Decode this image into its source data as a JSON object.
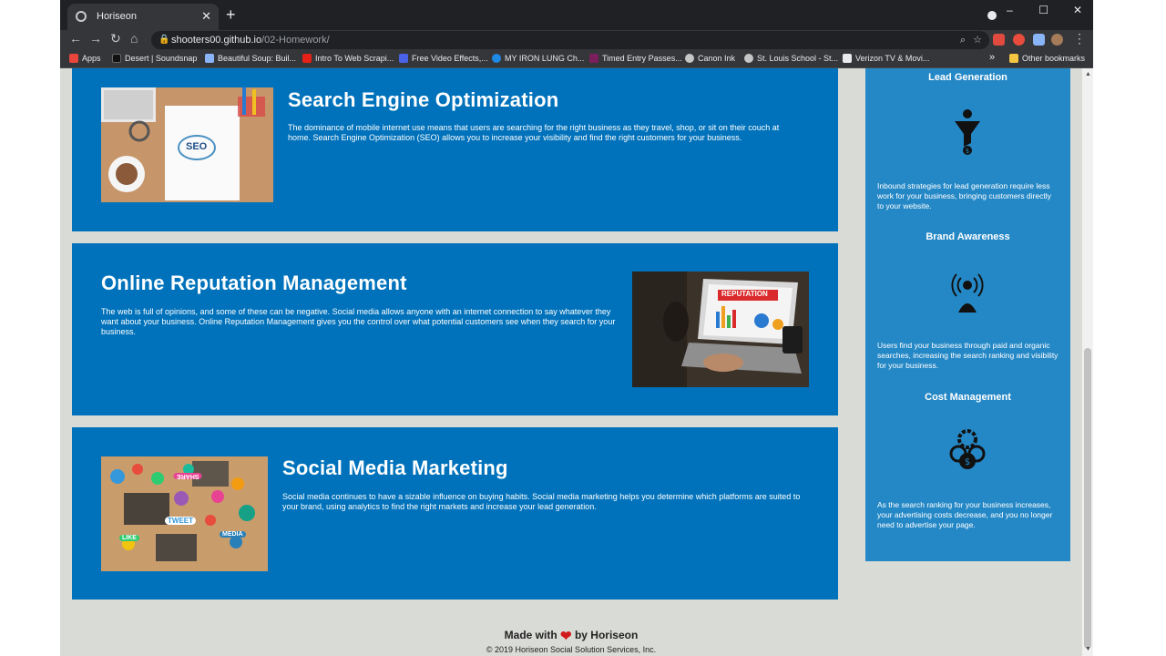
{
  "browser": {
    "tab_title": "Horiseon",
    "tab_close": "✕",
    "new_tab": "+",
    "url_host": "shooters00.github.io",
    "url_path": "/02-Homework/",
    "window_controls": [
      "–",
      "☐",
      "✕"
    ]
  },
  "bookmarks": [
    {
      "label": "Apps",
      "icon": "apps-grid-icon",
      "color": "#e8453c"
    },
    {
      "label": "Desert | Soundsnap",
      "icon": "soundsnap-icon",
      "color": "#111111"
    },
    {
      "label": "Beautiful Soup: Buil...",
      "icon": "soup-icon",
      "color": "#8ab4f8"
    },
    {
      "label": "Intro To Web Scrapi...",
      "icon": "youtube-icon",
      "color": "#e62117"
    },
    {
      "label": "Free Video Effects,...",
      "icon": "vfx-icon",
      "color": "#4a63e6"
    },
    {
      "label": "MY IRON LUNG Ch...",
      "icon": "ultimate-guitar-icon",
      "color": "#1e88e5"
    },
    {
      "label": "Timed Entry Passes...",
      "icon": "museum-icon",
      "color": "#7b1f5c"
    },
    {
      "label": "Canon Ink",
      "icon": "globe-icon",
      "color": "#c4c7c5"
    },
    {
      "label": "St. Louis School - St...",
      "icon": "wordpress-icon",
      "color": "#c4c7c5"
    },
    {
      "label": "Verizon TV & Movi...",
      "icon": "verizon-icon",
      "color": "#e8eaed"
    },
    {
      "label": "»",
      "icon": "overflow-chevron-icon",
      "color": "#e8eaed"
    },
    {
      "label": "Other bookmarks",
      "icon": "folder-icon",
      "color": "#f4c542"
    }
  ],
  "cards": [
    {
      "title": "Search Engine Optimization",
      "text": "The dominance of mobile internet use means that users are searching for the right business as they travel, shop, or sit on their couch at home. Search Engine Optimization (SEO) allows you to increase your visibility and find the right customers for your business.",
      "image": "seo-notebook-image",
      "image_text": "SEO"
    },
    {
      "title": "Online Reputation Management",
      "text": "The web is full of opinions, and some of these can be negative. Social media allows anyone with an internet connection to say whatever they want about your business. Online Reputation Management gives you the control over what potential customers see when they search for your business.",
      "image": "reputation-laptop-image",
      "image_text": "REPUTATION"
    },
    {
      "title": "Social Media Marketing",
      "text": "Social media continues to have a sizable influence on buying habits. Social media marketing helps you determine which platforms are suited to your brand, using analytics to find the right markets and increase your lead generation.",
      "image": "social-media-table-image",
      "image_text": [
        "SHARE",
        "TWEET",
        "LIKE",
        "MEDIA"
      ]
    }
  ],
  "benefits": [
    {
      "title": "Lead Generation",
      "icon": "lead-funnel-icon",
      "text": "Inbound strategies for lead generation require less work for your business, bringing customers directly to your website."
    },
    {
      "title": "Brand Awareness",
      "icon": "brand-broadcast-icon",
      "text": "Users find your business through paid and organic searches, increasing the search ranking and visibility for your business."
    },
    {
      "title": "Cost Management",
      "icon": "cost-gears-dollar-icon",
      "text": "As the search ranking for your business increases, your advertising costs decrease, and you no longer need to advertise your page."
    }
  ],
  "footer": {
    "made_with": "Made with",
    "by": "by Horiseon",
    "heart": "❤",
    "copyright": "© 2019 Horiseon Social Solution Services, Inc."
  },
  "colors": {
    "card_blue": "#0072bb",
    "aside_blue": "#2588c6",
    "page_bg": "#d9dbd6"
  }
}
